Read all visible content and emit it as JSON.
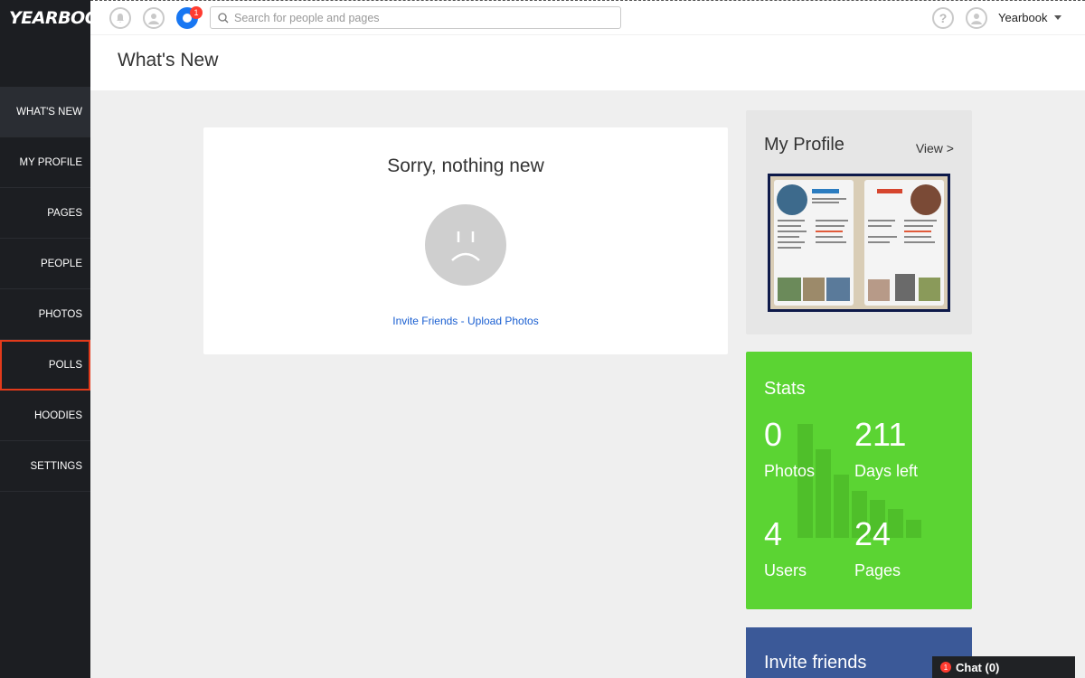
{
  "app": {
    "logo": "YEARBOOK"
  },
  "sidebar": {
    "items": [
      {
        "label": "WHAT'S NEW"
      },
      {
        "label": "MY PROFILE"
      },
      {
        "label": "PAGES"
      },
      {
        "label": "PEOPLE"
      },
      {
        "label": "PHOTOS"
      },
      {
        "label": "POLLS"
      },
      {
        "label": "HOODIES"
      },
      {
        "label": "SETTINGS"
      }
    ]
  },
  "topbar": {
    "notification_count": "1",
    "search_placeholder": "Search for people and pages",
    "help_glyph": "?",
    "username": "Yearbook"
  },
  "header": {
    "title": "What's New"
  },
  "main": {
    "empty_title": "Sorry, nothing new",
    "invite_link": "Invite Friends",
    "separator": " - ",
    "upload_link": "Upload Photos"
  },
  "profile": {
    "title": "My Profile",
    "view_label": "View >"
  },
  "stats": {
    "title": "Stats",
    "photos_value": "0",
    "photos_label": "Photos",
    "days_value": "211",
    "days_label": "Days left",
    "users_value": "4",
    "users_label": "Users",
    "pages_value": "24",
    "pages_label": "Pages"
  },
  "invite": {
    "title": "Invite friends"
  },
  "chat": {
    "label": "Chat (0)",
    "badge": "1"
  },
  "colors": {
    "sidebar_bg": "#1c1e22",
    "stats_green": "#5bd433",
    "invite_blue": "#3b5998",
    "link_blue": "#1a5fd1",
    "highlight_red": "#e23a1b"
  }
}
